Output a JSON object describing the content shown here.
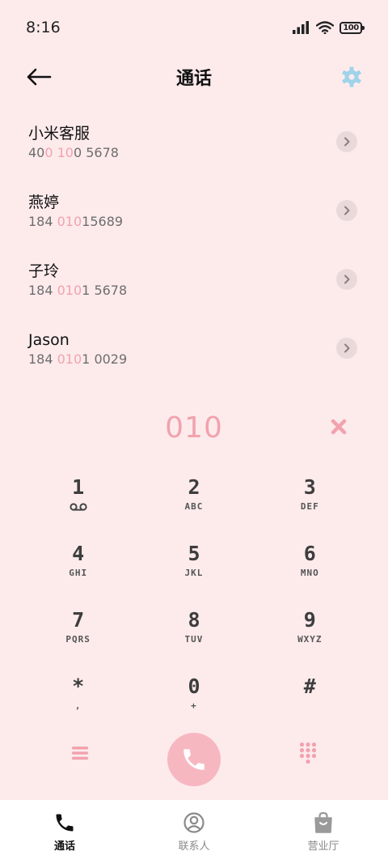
{
  "status_bar": {
    "time": "8:16",
    "battery": "100"
  },
  "header": {
    "title": "通话"
  },
  "results": [
    {
      "name": "小米客服",
      "number_parts": [
        {
          "text": "40",
          "hl": false
        },
        {
          "text": "0 10",
          "hl": true
        },
        {
          "text": "0 5678",
          "hl": false
        }
      ]
    },
    {
      "name": "燕婷",
      "number_parts": [
        {
          "text": "184 ",
          "hl": false
        },
        {
          "text": "010",
          "hl": true
        },
        {
          "text": "15689",
          "hl": false
        }
      ]
    },
    {
      "name": "子玲",
      "number_parts": [
        {
          "text": "184 ",
          "hl": false
        },
        {
          "text": "010",
          "hl": true
        },
        {
          "text": "1 5678",
          "hl": false
        }
      ]
    },
    {
      "name": "Jason",
      "number_parts": [
        {
          "text": "184 ",
          "hl": false
        },
        {
          "text": "010",
          "hl": true
        },
        {
          "text": "1 0029",
          "hl": false
        }
      ]
    }
  ],
  "dial": {
    "number": "010"
  },
  "keypad": [
    [
      {
        "digit": "1",
        "letters": ""
      },
      {
        "digit": "2",
        "letters": "ABC"
      },
      {
        "digit": "3",
        "letters": "DEF"
      }
    ],
    [
      {
        "digit": "4",
        "letters": "GHI"
      },
      {
        "digit": "5",
        "letters": "JKL"
      },
      {
        "digit": "6",
        "letters": "MNO"
      }
    ],
    [
      {
        "digit": "7",
        "letters": "PQRS"
      },
      {
        "digit": "8",
        "letters": "TUV"
      },
      {
        "digit": "9",
        "letters": "WXYZ"
      }
    ],
    [
      {
        "digit": "*",
        "letters": ","
      },
      {
        "digit": "0",
        "letters": "+"
      },
      {
        "digit": "#",
        "letters": ""
      }
    ]
  ],
  "tabs": [
    {
      "label": "通话",
      "icon": "phone-icon",
      "active": true
    },
    {
      "label": "联系人",
      "icon": "contact-icon",
      "active": false
    },
    {
      "label": "营业厅",
      "icon": "store-bag-icon",
      "active": false
    }
  ],
  "colors": {
    "accent": "#f2a2ae",
    "call_button": "#f7b7c1",
    "background": "#fdebec",
    "settings_icon": "#9fd3ea"
  }
}
